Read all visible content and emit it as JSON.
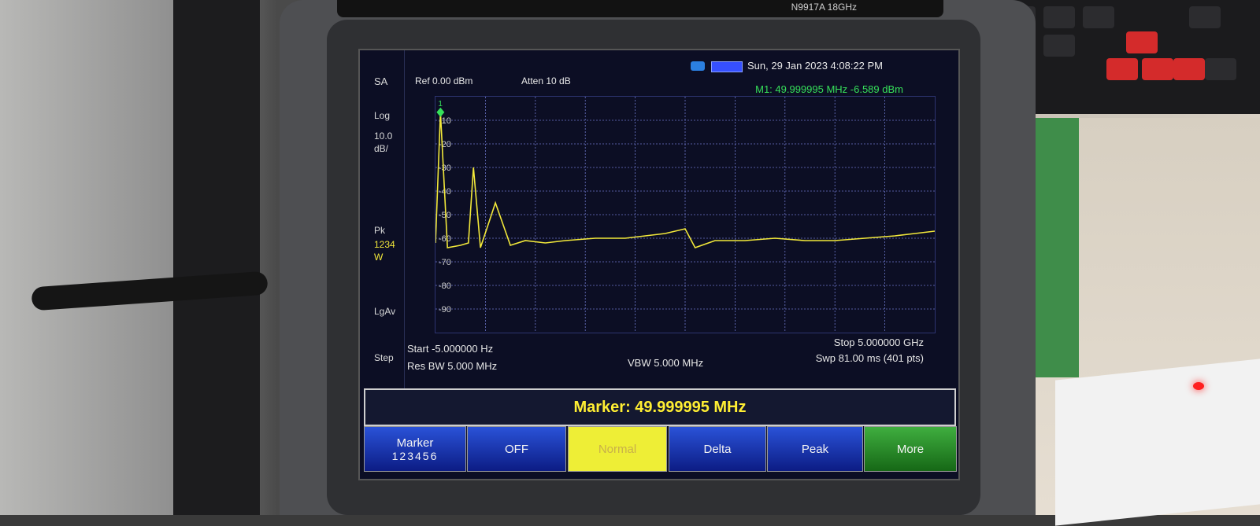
{
  "device": {
    "model_text": "N9917A   18GHz"
  },
  "status": {
    "datetime": "Sun, 29 Jan 2023 4:08:22 PM"
  },
  "header": {
    "ref": "Ref 0.00 dBm",
    "atten": "Atten 10 dB"
  },
  "marker_readout": "M1:  49.999995 MHz  -6.589 dBm",
  "left_panel": {
    "mode": "SA",
    "scale_type": "Log",
    "scale": "10.0",
    "scale_unit": "dB/",
    "detector": "Pk",
    "traces": "1234",
    "trace_state": "W",
    "averaging": "LgAv",
    "step": "Step"
  },
  "chart_data": {
    "type": "line",
    "title": "",
    "xlabel": "",
    "ylabel": "",
    "y_tick_labels": [
      "-10",
      "-20",
      "-30",
      "-40",
      "-50",
      "-60",
      "-70",
      "-80",
      "-90"
    ],
    "ylim": [
      -100,
      0
    ],
    "xlim": [
      -5e-06,
      5.0
    ],
    "x_unit": "GHz",
    "grid": true,
    "series": [
      {
        "color": "#f2e83a",
        "x": [
          0.0,
          0.05,
          0.12,
          0.25,
          0.33,
          0.38,
          0.45,
          0.6,
          0.75,
          0.9,
          1.1,
          1.3,
          1.6,
          1.9,
          2.1,
          2.3,
          2.5,
          2.6,
          2.8,
          3.1,
          3.4,
          3.7,
          4.0,
          4.3,
          4.6,
          4.8,
          5.0
        ],
        "values": [
          -62,
          -6.6,
          -64,
          -63,
          -62,
          -30,
          -64,
          -45,
          -63,
          -61,
          -62,
          -61,
          -60,
          -60,
          -59,
          -58,
          -56,
          -64,
          -61,
          -61,
          -60,
          -61,
          -61,
          -60,
          -59,
          -58,
          -57
        ]
      }
    ],
    "marker": {
      "label": "1",
      "x": 0.05,
      "y": -6.589
    }
  },
  "footer": {
    "start": "Start -5.000000  Hz",
    "stop": "Stop 5.000000 GHz",
    "rbw": "Res BW 5.000 MHz",
    "vbw": "VBW 5.000 MHz",
    "sweep": "Swp 81.00 ms (401 pts)"
  },
  "marker_bar": "Marker:  49.999995 MHz",
  "softkeys": {
    "marker": "Marker",
    "marker_nums": "123456",
    "off": "OFF",
    "normal": "Normal",
    "delta": "Delta",
    "peak": "Peak",
    "more": "More"
  },
  "colors": {
    "trace": "#f2e83a",
    "marker_text": "#36e05a",
    "screen_bg": "#0c0e24"
  }
}
